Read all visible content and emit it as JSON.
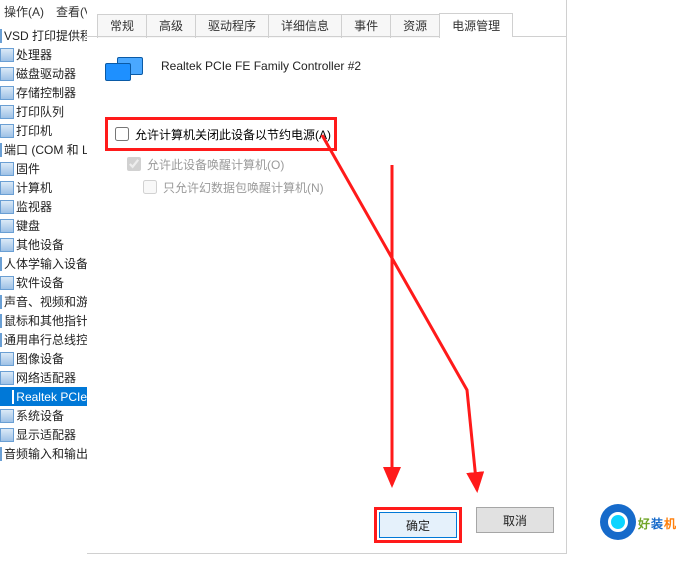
{
  "menubar": {
    "item1": "操作(A)",
    "item2": "查看(V"
  },
  "tree": {
    "items": [
      "VSD 打印提供程",
      "处理器",
      "磁盘驱动器",
      "存储控制器",
      "打印队列",
      "打印机",
      "端口 (COM 和 LP",
      "固件",
      "计算机",
      "监视器",
      "键盘",
      "其他设备",
      "人体学输入设备",
      "软件设备",
      "声音、视频和游戏",
      "鼠标和其他指针设",
      "通用串行总线控制",
      "图像设备",
      "网络适配器",
      "Realtek PCIe",
      "系统设备",
      "显示适配器",
      "音频输入和输出"
    ],
    "selected_index": 19
  },
  "tabs": {
    "t0": "常规",
    "t1": "高级",
    "t2": "驱动程序",
    "t3": "详细信息",
    "t4": "事件",
    "t5": "资源",
    "t6": "电源管理"
  },
  "device": {
    "name": "Realtek PCIe FE Family Controller #2"
  },
  "chk": {
    "c1": "允许计算机关闭此设备以节约电源(A)",
    "c2": "允许此设备唤醒计算机(O)",
    "c3": "只允许幻数据包唤醒计算机(N)",
    "c1_checked": false,
    "c2_checked": true,
    "c3_checked": false
  },
  "buttons": {
    "ok": "确定",
    "cancel": "取消"
  },
  "watermark": {
    "brand": "好装机"
  }
}
